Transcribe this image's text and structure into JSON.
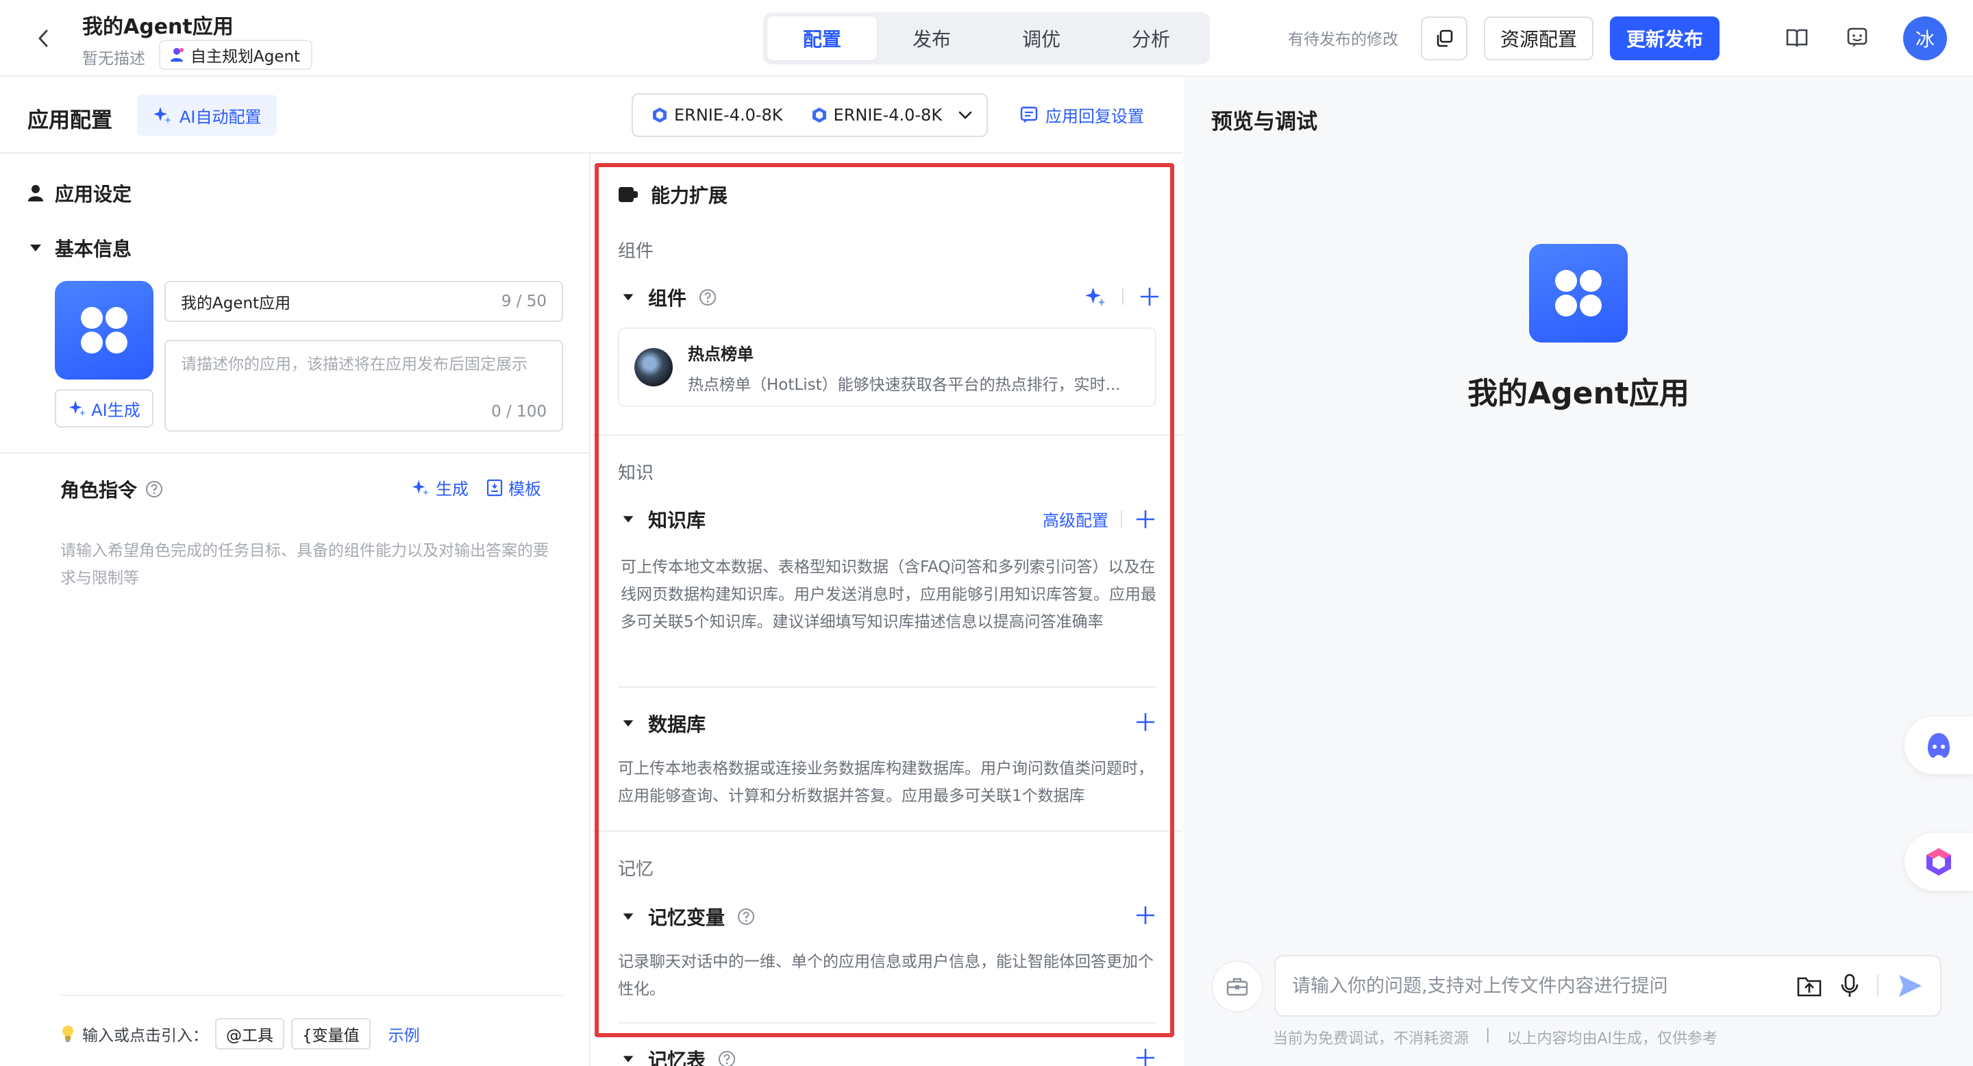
{
  "header": {
    "app_title": "我的Agent应用",
    "app_desc": "暂无描述",
    "agent_type": "自主规划Agent",
    "tabs": [
      "配置",
      "发布",
      "调优",
      "分析"
    ],
    "pending": "有待发布的修改",
    "resource_btn": "资源配置",
    "publish_btn": "更新发布",
    "avatar_text": "冰"
  },
  "config": {
    "title": "应用配置",
    "ai_auto": "AI自动配置",
    "model_1": "ERNIE-4.0-8K",
    "model_2": "ERNIE-4.0-8K",
    "reply_setting": "应用回复设置"
  },
  "left": {
    "app_setting": "应用设定",
    "basic_info": "基本信息",
    "name_value": "我的Agent应用",
    "name_count": "9 / 50",
    "desc_placeholder": "请描述你的应用，该描述将在应用发布后固定展示",
    "desc_count": "0 / 100",
    "ai_gen": "AI生成",
    "role_title": "角色指令",
    "gen_btn": "生成",
    "template_btn": "模板",
    "role_placeholder": "请输入希望角色完成的任务目标、具备的组件能力以及对输出答案的要求与限制等",
    "hint": "输入或点击引入：",
    "chip_tool": "@工具",
    "chip_var": "{变量值",
    "example": "示例"
  },
  "middle": {
    "title": "能力扩展",
    "group_components": "组件",
    "components_label": "组件",
    "plugin_name": "热点榜单",
    "plugin_desc": "热点榜单（HotList）能够快速获取各平台的热点排行，实时...",
    "group_knowledge": "知识",
    "kb_label": "知识库",
    "kb_advanced": "高级配置",
    "kb_desc": "可上传本地文本数据、表格型知识数据（含FAQ问答和多列索引问答）以及在线网页数据构建知识库。用户发送消息时，应用能够引用知识库答复。应用最多可关联5个知识库。建议详细填写知识库描述信息以提高问答准确率",
    "db_label": "数据库",
    "db_desc": "可上传本地表格数据或连接业务数据库构建数据库。用户询问数值类问题时，应用能够查询、计算和分析数据并答复。应用最多可关联1个数据库",
    "group_memory": "记忆",
    "mem_var_label": "记忆变量",
    "mem_var_desc": "记录聊天对话中的一维、单个的应用信息或用户信息，能让智能体回答更加个性化。",
    "mem_table_label": "记忆表"
  },
  "right": {
    "title": "预览与调试",
    "app_name": "我的Agent应用",
    "input_placeholder": "请输入你的问题,支持对上传文件内容进行提问",
    "footer_1": "当前为免费调试，不消耗资源",
    "footer_sep": "|",
    "footer_2": "以上内容均由AI生成，仅供参考"
  },
  "colors": {
    "accent": "#2b5cff",
    "highlight_box": "#e33b3b"
  },
  "icons": [
    "back-icon",
    "agent-icon",
    "copy-icon",
    "book-icon",
    "feedback-icon",
    "sparkle-icon",
    "model-icon",
    "reply-icon",
    "user-icon",
    "caret-down-icon",
    "clover-icon",
    "help-icon",
    "template-icon",
    "bulb-icon",
    "plugin-icon",
    "plus-icon",
    "toolbox-icon",
    "upload-icon",
    "mic-icon",
    "send-icon"
  ]
}
